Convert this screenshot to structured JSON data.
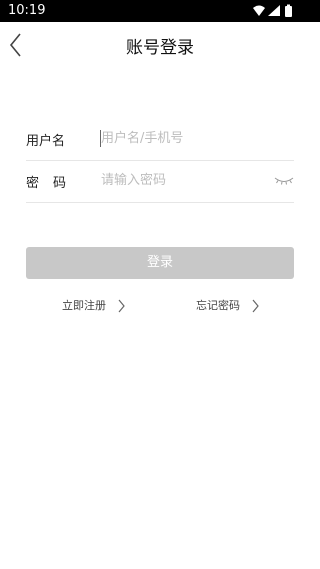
{
  "status_bar": {
    "time": "10:19",
    "icons": [
      "wifi-icon",
      "signal-icon",
      "battery-icon"
    ]
  },
  "header": {
    "title": "账号登录",
    "back_icon": "chevron-left-icon"
  },
  "form": {
    "username": {
      "label": "用户名",
      "placeholder": "用户名/手机号",
      "value": ""
    },
    "password": {
      "label": "密码",
      "placeholder": "请输入密码",
      "value": "",
      "toggle_icon": "eye-closed-icon"
    }
  },
  "login_button": {
    "label": "登录",
    "bg_color": "#c8c8c8"
  },
  "links": {
    "register": {
      "label": "立即注册"
    },
    "forgot_password": {
      "label": "忘记密码"
    }
  }
}
